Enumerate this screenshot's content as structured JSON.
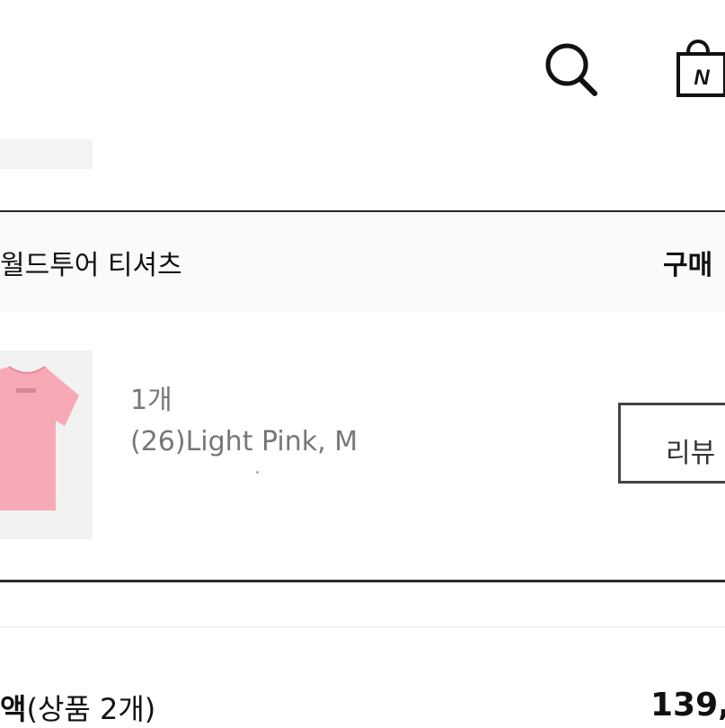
{
  "header": {
    "search_icon": "search-icon",
    "bag_icon": "shopping-bag-icon",
    "bag_letter": "N"
  },
  "product": {
    "name": "월드투어 티셔츠",
    "purchase_label": "구매",
    "quantity": "1개",
    "option": "(26)Light Pink, M",
    "review_button": "리뷰",
    "image_color": "#f7a9b5"
  },
  "summary": {
    "total_label_bold": "액",
    "total_label_rest": "(상품 2개)",
    "total_value": "139,"
  }
}
